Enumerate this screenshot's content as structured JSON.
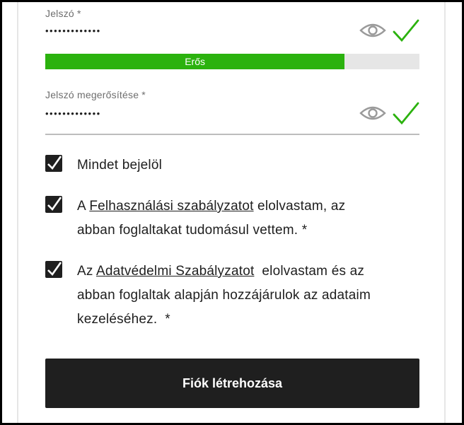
{
  "password": {
    "label": "Jelszó *",
    "masked_value": "•••••••••••••",
    "strength": {
      "label": "Erős",
      "level": 0.8
    }
  },
  "confirm": {
    "label": "Jelszó megerősítése *",
    "masked_value": "•••••••••••••"
  },
  "checkboxes": {
    "all": {
      "label": "Mindet bejelöl",
      "checked": true
    },
    "terms": {
      "prefix": "A ",
      "link": "Felhasználási szabályzatot",
      "suffix_line1": " elolvastam, az",
      "line2": "abban foglaltakat tudomásul vettem. *",
      "checked": true
    },
    "privacy": {
      "prefix": "Az ",
      "link": "Adatvédelmi Szabályzatot",
      "suffix_line1": "  elolvastam és az",
      "line2": "abban foglaltak alapján hozzájárulok az adataim",
      "line3": "kezeléséhez.  *",
      "checked": true
    }
  },
  "submit": {
    "label": "Fiók létrehozása"
  },
  "colors": {
    "valid": "#2bb20e",
    "strength_fill": "#2bb20e",
    "button": "#1f1f1f"
  },
  "icons": {
    "reveal": "eye-icon",
    "valid": "checkmark-icon",
    "checkbox": "checkbox-checked-icon"
  }
}
